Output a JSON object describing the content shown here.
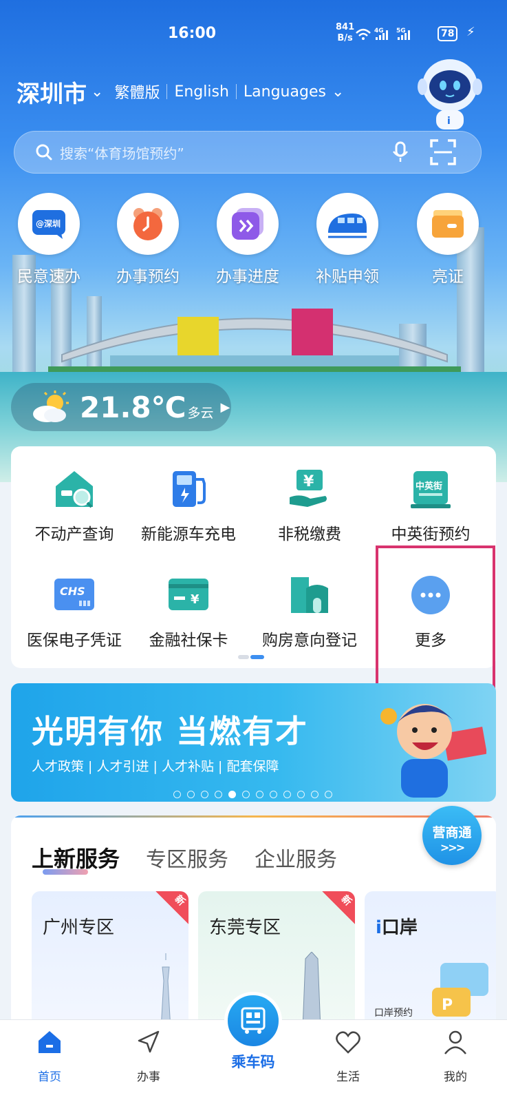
{
  "status_bar": {
    "time": "16:00",
    "net_speed_value": "841",
    "net_speed_unit": "B/s",
    "signal": "4G 5G",
    "battery": "78"
  },
  "header": {
    "city": "深圳市",
    "lang_traditional": "繁體版",
    "lang_english": "English",
    "lang_languages": "Languages"
  },
  "search": {
    "placeholder": "搜索“体育场馆预约”"
  },
  "quick_links": [
    {
      "label": "民意速办",
      "icon": "shenzhen-chat-icon"
    },
    {
      "label": "办事预约",
      "icon": "alarm-clock-icon"
    },
    {
      "label": "办事进度",
      "icon": "fast-forward-icon"
    },
    {
      "label": "补贴申领",
      "icon": "train-icon"
    },
    {
      "label": "亮证",
      "icon": "wallet-icon"
    }
  ],
  "weather": {
    "temperature": "21.8℃",
    "description": "多云",
    "icon": "partly-cloudy-icon"
  },
  "services": [
    {
      "label": "不动产查询",
      "icon": "house-search-icon"
    },
    {
      "label": "新能源车充电",
      "icon": "ev-charger-icon"
    },
    {
      "label": "非税缴费",
      "icon": "yuan-payment-icon"
    },
    {
      "label": "中英街预约",
      "icon": "zhongyingjie-sign-icon",
      "icon_text": "中英街"
    },
    {
      "label": "医保电子凭证",
      "icon": "chs-card-icon",
      "icon_text": "CHS"
    },
    {
      "label": "金融社保卡",
      "icon": "bank-card-icon",
      "icon_text": "¥"
    },
    {
      "label": "购房意向登记",
      "icon": "building-icon"
    },
    {
      "label": "更多",
      "icon": "more-dots-icon"
    }
  ],
  "banner": {
    "title": "光明有你 当燃有才",
    "subtitle": "人才政策 | 人才引进 | 人才补贴 | 配套保障",
    "active_slide": 5,
    "slide_count": 12
  },
  "new_services": {
    "tabs": [
      "上新服务",
      "专区服务",
      "企业服务"
    ],
    "floating_button": "营商通",
    "cards": [
      {
        "title": "广州专区",
        "badge": "新"
      },
      {
        "title": "东莞专区",
        "badge": "新"
      },
      {
        "title": "口岸",
        "caption": "口岸预约"
      }
    ]
  },
  "bottom_nav": [
    {
      "label": "首页",
      "icon": "home-icon",
      "active": true
    },
    {
      "label": "办事",
      "icon": "navigation-arrow-icon",
      "active": false
    },
    {
      "label": "乘车码",
      "icon": "bus-qr-icon",
      "active": false
    },
    {
      "label": "生活",
      "icon": "heart-icon",
      "active": false
    },
    {
      "label": "我的",
      "icon": "user-icon",
      "active": false
    }
  ],
  "colors": {
    "primary_blue": "#1b6ee6",
    "highlight_border": "#d8336e",
    "new_badge": "#f04d5a"
  }
}
